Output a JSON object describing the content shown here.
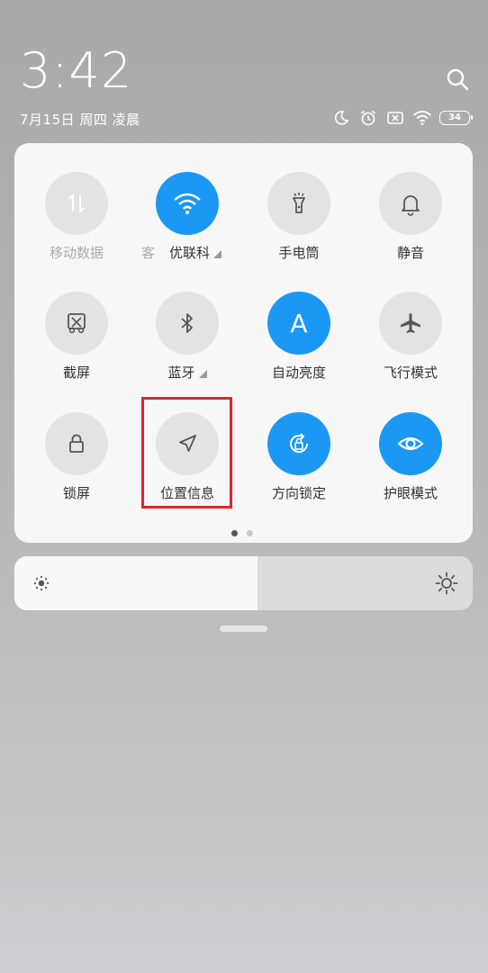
{
  "status_bar": {
    "time": "3:42",
    "date": "7月15日 周四 凌晨",
    "battery": "34"
  },
  "tiles": [
    {
      "label": "移动数据",
      "state": "disabled",
      "icon": "mobile-data-icon"
    },
    {
      "label_prefix": "客",
      "label": "优联科",
      "state": "on",
      "icon": "wifi-icon",
      "has_menu": true
    },
    {
      "label": "手电筒",
      "state": "off",
      "icon": "flashlight-icon"
    },
    {
      "label": "静音",
      "state": "off",
      "icon": "bell-icon"
    },
    {
      "label": "截屏",
      "state": "off",
      "icon": "screenshot-icon"
    },
    {
      "label": "蓝牙",
      "state": "off",
      "icon": "bluetooth-icon",
      "has_menu": true
    },
    {
      "label": "自动亮度",
      "state": "on",
      "icon": "auto-brightness-icon",
      "glyph": "A"
    },
    {
      "label": "飞行模式",
      "state": "off",
      "icon": "airplane-icon"
    },
    {
      "label": "锁屏",
      "state": "off",
      "icon": "lock-icon"
    },
    {
      "label": "位置信息",
      "state": "off",
      "icon": "location-icon"
    },
    {
      "label": "方向锁定",
      "state": "on",
      "icon": "rotation-lock-icon"
    },
    {
      "label": "护眼模式",
      "state": "on",
      "icon": "eye-icon"
    }
  ],
  "pager": {
    "pages": 2,
    "current": 1
  },
  "brightness": {
    "level": 0.53
  },
  "colors": {
    "accent": "#1a98f3",
    "highlight": "#e0262b"
  }
}
